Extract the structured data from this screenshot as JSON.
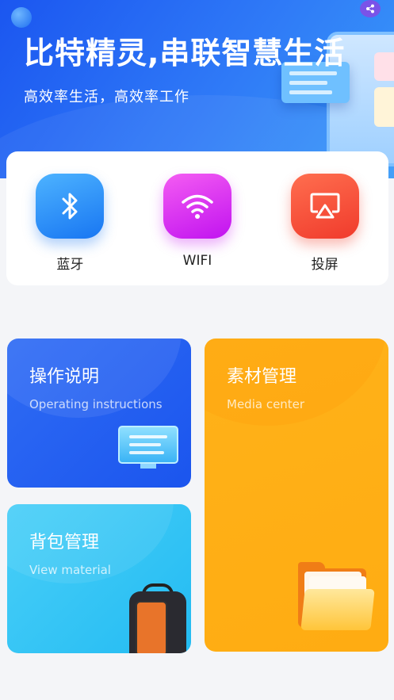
{
  "hero": {
    "title": "比特精灵,串联智慧生活",
    "subtitle": "高效率生活，高效率工作"
  },
  "quick_actions": [
    {
      "label": "蓝牙",
      "icon": "bluetooth-icon",
      "color": "#1e7cf2"
    },
    {
      "label": "WIFI",
      "icon": "wifi-icon",
      "color": "#d526f1"
    },
    {
      "label": "投屏",
      "icon": "screen-cast-icon",
      "color": "#f2452f"
    }
  ],
  "cards": {
    "operating": {
      "title": "操作说明",
      "subtitle": "Operating instructions"
    },
    "media": {
      "title": "素材管理",
      "subtitle": "Media center"
    },
    "backpack": {
      "title": "背包管理",
      "subtitle": "View material"
    }
  },
  "colors": {
    "hero_blue": "#1f5ef2",
    "card_blue": "#2563f0",
    "card_orange": "#ffaf16",
    "card_cyan": "#36c5f5"
  }
}
